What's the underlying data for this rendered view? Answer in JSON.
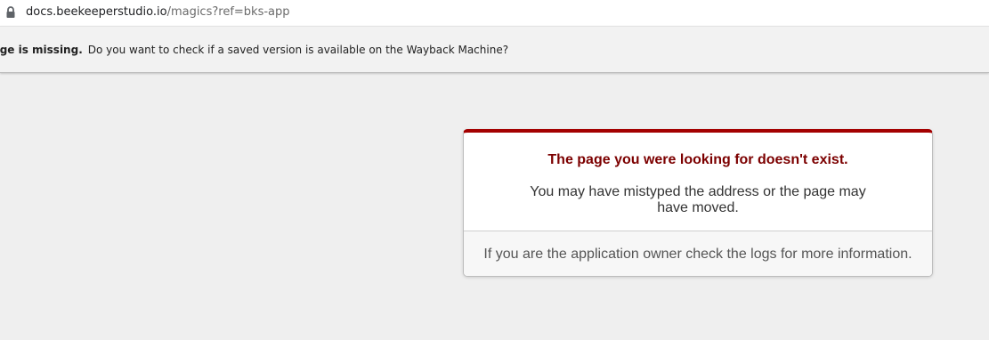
{
  "address_bar": {
    "url_host": "docs.beekeeperstudio.io",
    "url_path": "/magics?ref=bks-app",
    "lock_icon": "lock-icon"
  },
  "infobar": {
    "bold_text": "at page is missing.",
    "message": "Do you want to check if a saved version is available on the Wayback Machine?"
  },
  "error_card": {
    "title": "The page you were looking for doesn't exist.",
    "description": "You may have mistyped the address or the page may have moved.",
    "footer": "If you are the application owner check the logs for more information.",
    "accent_color": "#a40000"
  }
}
